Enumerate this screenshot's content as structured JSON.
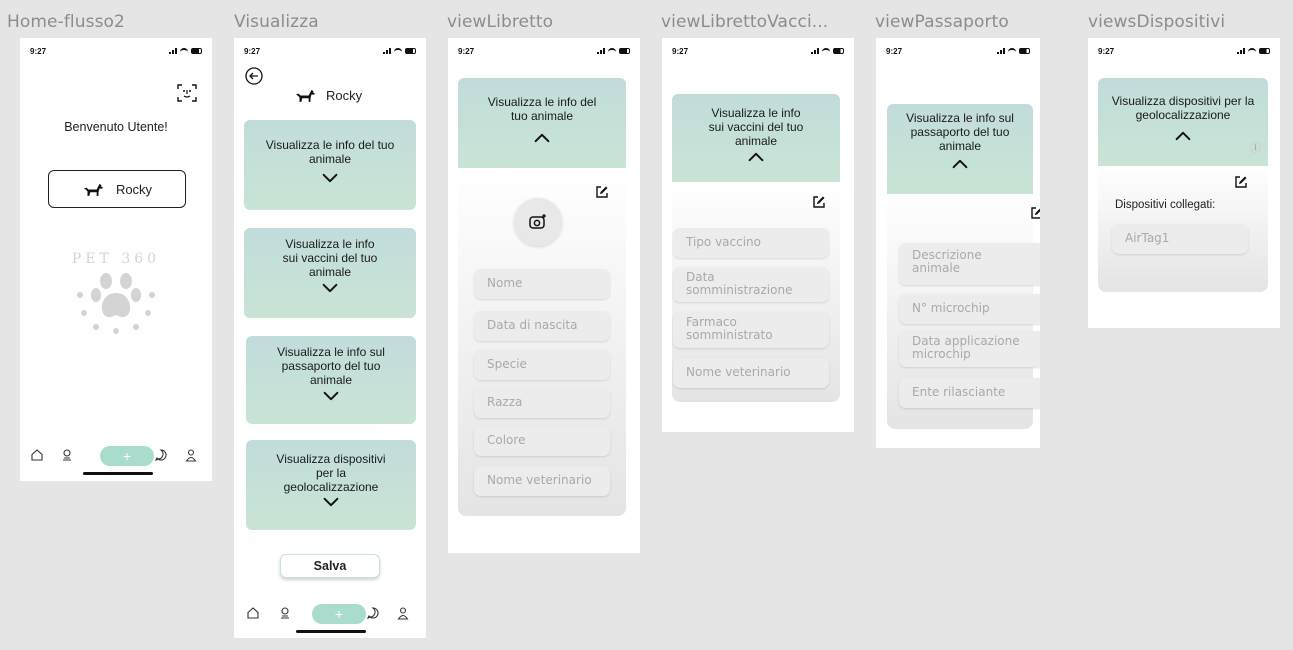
{
  "frames": {
    "home": {
      "title": "Home-flusso2",
      "time": "9:27",
      "welcome": "Benvenuto Utente!",
      "pet_button": "Rocky",
      "logo_text": "PET 360"
    },
    "visualizza": {
      "title": "Visualizza",
      "time": "9:27",
      "pet_name": "Rocky",
      "cards": [
        "Visualizza le info del tuo animale",
        "Visualizza le info sui vaccini del tuo animale",
        "Visualizza le info sul passaporto del tuo animale",
        "Visualizza dispositivi per la geolocalizzazione"
      ],
      "save": "Salva"
    },
    "libretto": {
      "title": "viewLibretto",
      "time": "9:27",
      "header": "Visualizza le info del tuo animale",
      "fields": [
        "Nome",
        "Data di nascita",
        "Specie",
        "Razza",
        "Colore",
        "Nome veterinario"
      ]
    },
    "vaccini": {
      "title": "viewLibrettoVacci...",
      "time": "9:27",
      "header": "Visualizza le info sui vaccini del tuo animale",
      "fields": [
        "Tipo vaccino",
        "Data somministrazione",
        "Farmaco somministrato",
        "Nome veterinario"
      ]
    },
    "passaporto": {
      "title": "viewPassaporto",
      "time": "9:27",
      "header": "Visualizza le info sul passaporto del tuo animale",
      "fields": [
        "Descrizione animale",
        "N° microchip",
        "Data applicazione microchip",
        "Ente rilasciante"
      ]
    },
    "dispositivi": {
      "title": "viewsDispositivi",
      "time": "9:27",
      "header": "Visualizza dispositivi per la geolocalizzazione",
      "label": "Dispositivi collegati:",
      "device": "AirTag1",
      "info": "i"
    }
  },
  "colors": {
    "card_top": "#c2dcdc",
    "card_bottom": "#c9e4d5",
    "plus_pill": "#a9dccc",
    "field_bg": "#ececec"
  }
}
